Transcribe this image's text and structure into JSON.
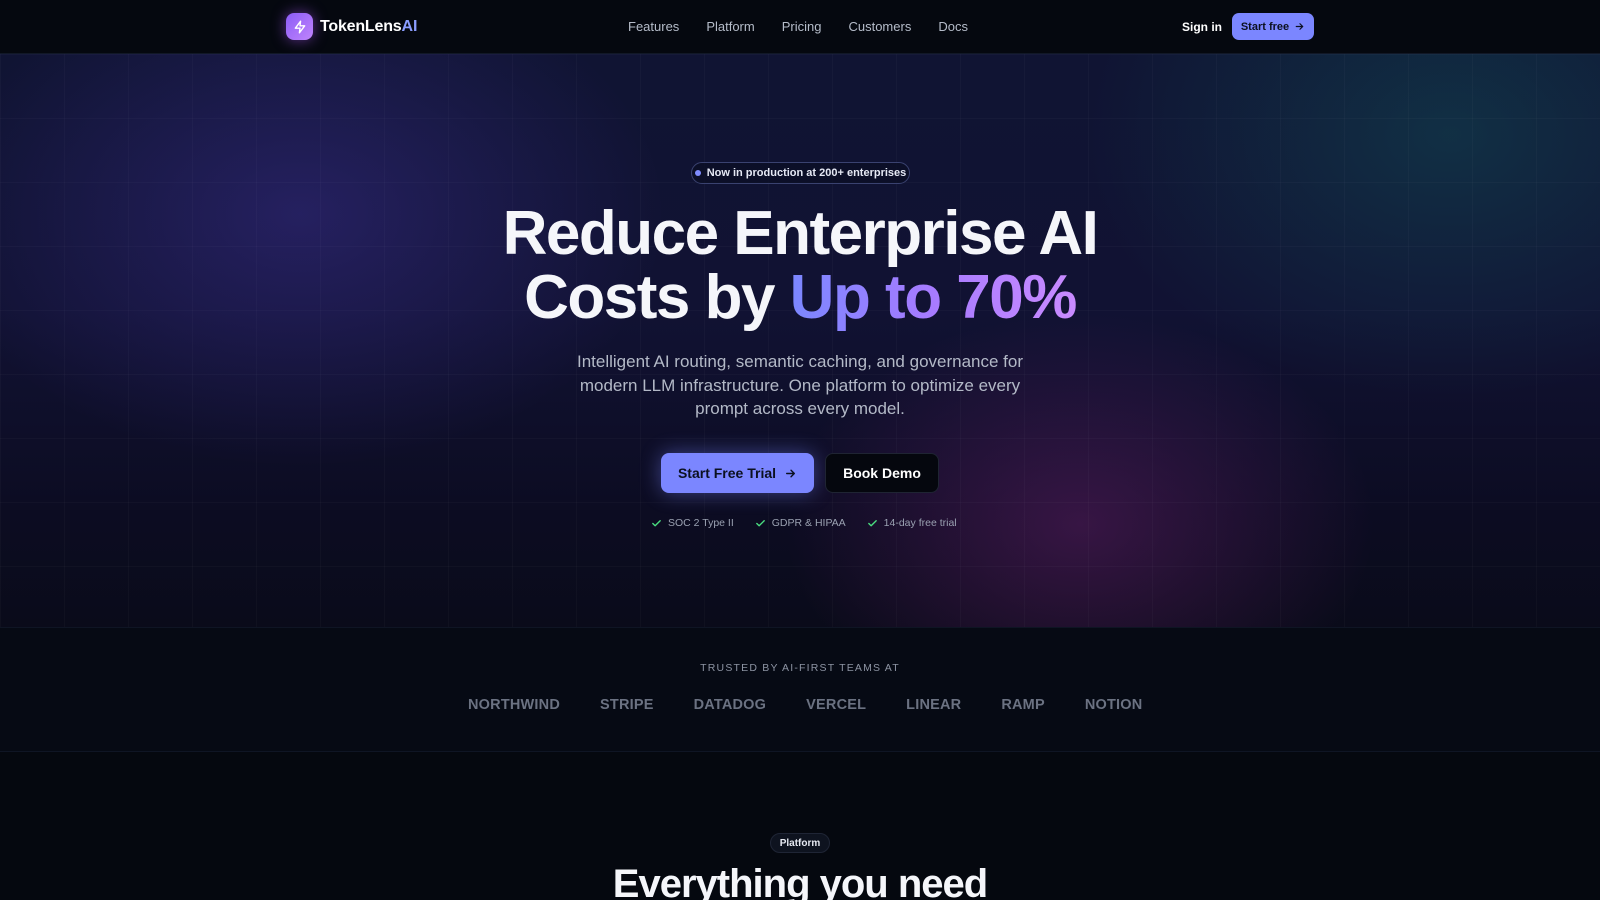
{
  "nav": {
    "brand_main": "TokenLens",
    "brand_accent": "AI",
    "brand_icon": "bolt-icon",
    "links": [
      {
        "label": "Features"
      },
      {
        "label": "Platform"
      },
      {
        "label": "Pricing"
      },
      {
        "label": "Customers"
      },
      {
        "label": "Docs"
      }
    ],
    "signin_label": "Sign in",
    "start_free_label": "Start free"
  },
  "hero": {
    "pill_text": "Now in production at 200+ enterprises",
    "headline_line1": "Reduce Enterprise AI",
    "headline_line2_prefix": "Costs by ",
    "headline_highlight": "Up to 70%",
    "subhead": "Intelligent AI routing, semantic caching, and governance for modern LLM infrastructure. One platform to optimize every prompt across every model.",
    "primary_cta": "Start Free Trial",
    "secondary_cta": "Book Demo",
    "badges": [
      {
        "label": "SOC 2 Type II"
      },
      {
        "label": "GDPR & HIPAA"
      },
      {
        "label": "14-day free trial"
      }
    ]
  },
  "trusted": {
    "title": "TRUSTED BY AI-FIRST TEAMS AT",
    "logos": [
      "NORTHWIND",
      "STRIPE",
      "DATADOG",
      "VERCEL",
      "LINEAR",
      "RAMP",
      "NOTION"
    ]
  },
  "platform": {
    "pill": "Platform",
    "title": "Everything you need"
  },
  "colors": {
    "accent": "#7b86ff",
    "highlight_gradient_start": "#7b87ff",
    "highlight_gradient_end": "#c98bff",
    "check_green": "#4ade80",
    "background": "#05080f"
  }
}
